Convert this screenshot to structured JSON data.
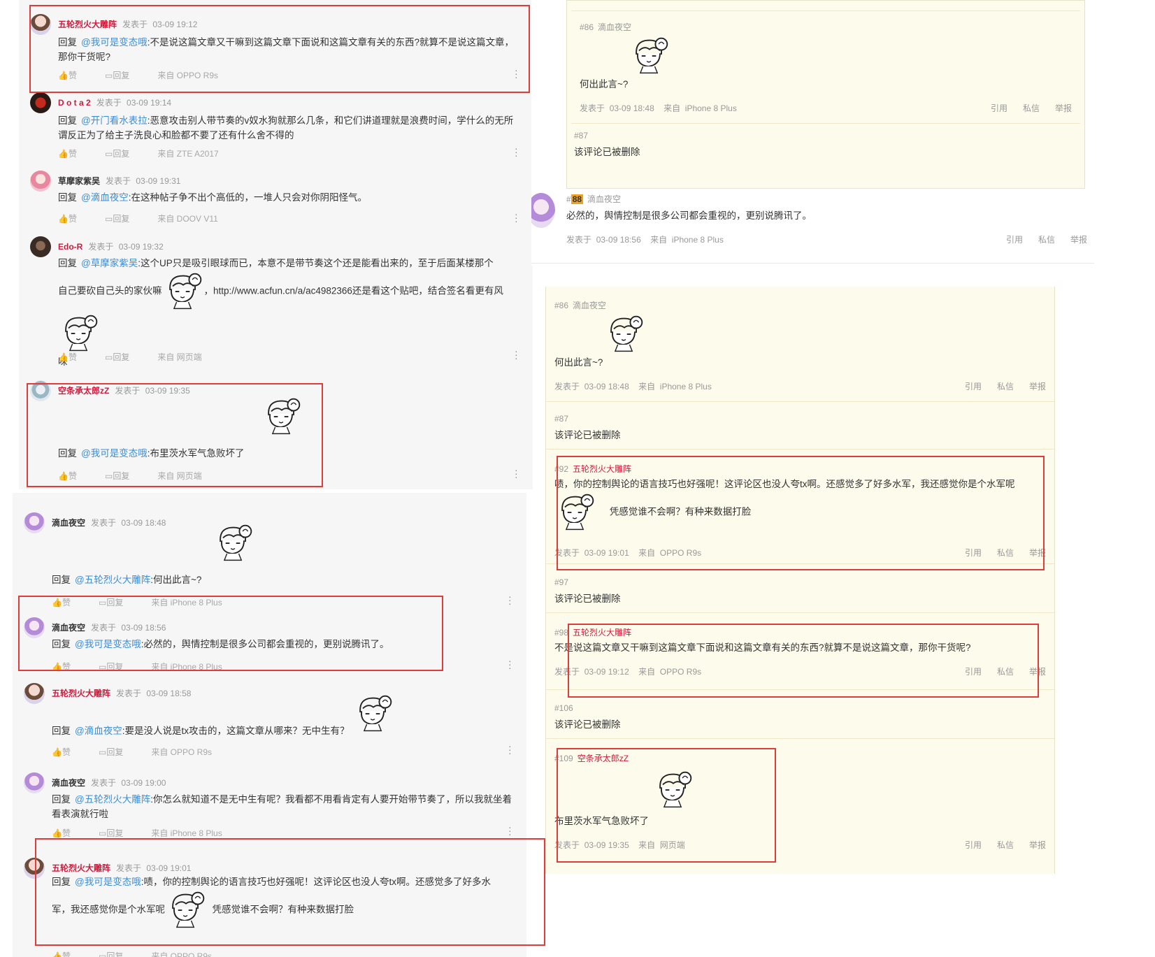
{
  "toolbar_labels": {
    "like": "赞",
    "reply": "回复",
    "reply_prefix": "回复",
    "posted": "发表于"
  },
  "forum_labels": {
    "quote": "引用",
    "message": "私信",
    "report": "举报",
    "posted": "发表于",
    "from": "来自"
  },
  "panel1": {
    "comments": [
      {
        "user": "五轮烈火大雕阵",
        "time": "03-09  19:12",
        "at": "@我可是变态哦",
        "text": ":不是说这篇文章又干嘛到这篇文章下面说和这篇文章有关的东西?就算不是说这篇文章，那你干货呢?",
        "device": "来自 OPPO  R9s"
      },
      {
        "user": "D o t a 2",
        "time": "03-09  19:14",
        "at": "@开门看水表拉",
        "text": ":恶意攻击别人带节奏的v奴水狗就那么几条，和它们讲道理就是浪费时间，学什么的无所谓反正为了给主子洗良心和脸都不要了还有什么舍不得的",
        "device": "来自 ZTE  A2017"
      },
      {
        "user": "草摩家紫吴",
        "time": "03-09  19:31",
        "at": "@滴血夜空",
        "text": ":在这种帖子争不出个高低的，一堆人只会对你阴阳怪气。",
        "device": "来自 DOOV  V11"
      },
      {
        "user": "Edo-R",
        "time": "03-09  19:32",
        "at": "@草摩家紫吴",
        "text1": ":这个UP只是吸引眼球而已，本意不是带节奏这个还是能看出来的，至于后面某楼那个",
        "text2": "自己要砍自己头的家伙嘛",
        "text3": "，http://www.acfun.cn/a/ac4982366还是看这个贴吧，结合签名看更有风",
        "text4": "味",
        "device": "来自 网页端"
      },
      {
        "user": "空条承太郎zZ",
        "time": "03-09  19:35",
        "at": "@我可是变态哦",
        "text": ":布里茨水军气急败坏了",
        "device": "来自 网页端"
      }
    ]
  },
  "panel2": {
    "comments": [
      {
        "user": "滴血夜空",
        "time": "03-09  18:48",
        "at": "@五轮烈火大雕阵",
        "text": ":何出此言~?",
        "device": "来自 iPhone  8  Plus"
      },
      {
        "user": "滴血夜空",
        "time": "03-09  18:56",
        "at": "@我可是变态哦",
        "text": ":必然的，舆情控制是很多公司都会重视的，更别说腾讯了。",
        "device": "来自 iPhone  8  Plus"
      },
      {
        "user": "五轮烈火大雕阵",
        "time": "03-09  18:58",
        "at": "@滴血夜空",
        "text": ":要是没人说是tx攻击的，这篇文章从哪来？无中生有？",
        "device": "来自 OPPO  R9s"
      },
      {
        "user": "滴血夜空",
        "time": "03-09  19:00",
        "at": "@五轮烈火大雕阵",
        "text": ":你怎么就知道不是无中生有呢？我看都不用看肯定有人要开始带节奏了，所以我就坐着看表演就行啦",
        "device": "来自 iPhone  8  Plus"
      },
      {
        "user": "五轮烈火大雕阵",
        "time": "03-09  19:01",
        "at": "@我可是变态哦",
        "text1": ":啧，你的控制舆论的语言技巧也好强呢！这评论区也没人夸tx啊。还感觉多了好多水",
        "text2": "军，我还感觉你是个水军呢",
        "text3": "凭感觉谁不会啊？有种来数据打脸",
        "device": "来自 OPPO  R9s"
      }
    ]
  },
  "panel3": {
    "posts": [
      {
        "floor": "#86",
        "user": "滴血夜空",
        "text": "何出此言~?",
        "time": "03-09  18:48",
        "device": "iPhone  8  Plus"
      },
      {
        "floor": "#87",
        "text": "该评论已被删除"
      },
      {
        "floor_prefix": "#",
        "floor_num": "88",
        "user": "滴血夜空",
        "text": "必然的，舆情控制是很多公司都会重视的，更别说腾讯了。",
        "time": "03-09  18:56",
        "device": "iPhone  8  Plus"
      }
    ]
  },
  "panel4": {
    "posts": [
      {
        "floor": "#86",
        "user": "滴血夜空",
        "text": "何出此言~?",
        "time": "03-09  18:48",
        "device": "iPhone  8  Plus"
      },
      {
        "floor": "#87",
        "text": "该评论已被删除"
      },
      {
        "floor": "#92",
        "user": "五轮烈火大雕阵",
        "text1": "啧，你的控制舆论的语言技巧也好强呢！这评论区也没人夸tx啊。还感觉多了好多水军，我还感觉你是个水军呢",
        "text2": "凭感觉谁不会啊？有种来数据打脸",
        "time": "03-09  19:01",
        "device": "OPPO  R9s"
      },
      {
        "floor": "#97",
        "text": "该评论已被删除"
      },
      {
        "floor": "#98",
        "user": "五轮烈火大雕阵",
        "text": "不是说这篇文章又干嘛到这篇文章下面说和这篇文章有关的东西?就算不是说这篇文章，那你干货呢?",
        "time": "03-09  19:12",
        "device": "OPPO  R9s"
      },
      {
        "floor": "#106",
        "text": "该评论已被删除"
      },
      {
        "floor": "#109",
        "user": "空条承太郎zZ",
        "text": "布里茨水军气急败坏了",
        "time": "03-09  19:35",
        "device": "网页端"
      }
    ]
  },
  "colors": {
    "username": "#d01a3c",
    "mention": "#3a8ed8",
    "highlight_box": "#e03c3c",
    "forum_bg": "#fdfbeb",
    "floor_badge": "#f2a11a"
  }
}
